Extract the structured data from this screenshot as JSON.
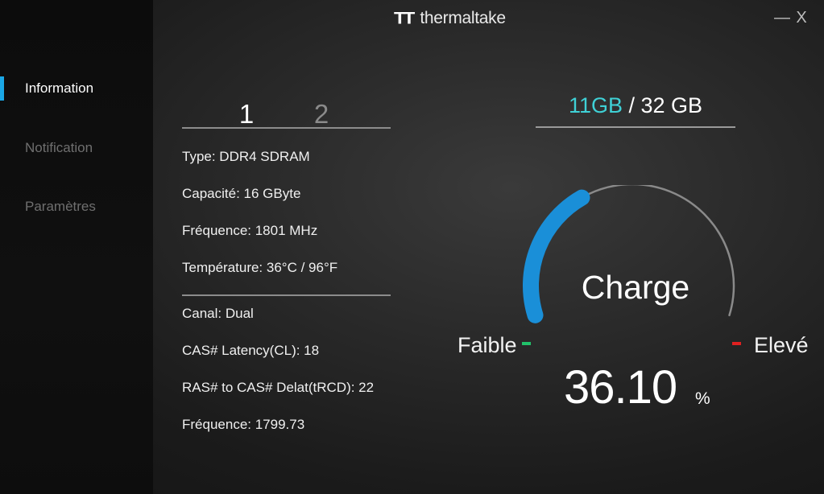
{
  "app": {
    "brand": "thermaltake",
    "logo_mark": "TT",
    "minimize_label": "—",
    "close_label": "X"
  },
  "sidebar": {
    "items": [
      {
        "label": "Information",
        "active": true
      },
      {
        "label": "Notification",
        "active": false
      },
      {
        "label": "Paramètres",
        "active": false
      }
    ]
  },
  "modules": {
    "tabs": [
      {
        "label": "1",
        "active": true
      },
      {
        "label": "2",
        "active": false
      }
    ]
  },
  "info": {
    "type": "Type: DDR4 SDRAM",
    "capacity": "Capacité: 16 GByte",
    "frequency": "Fréquence: 1801 MHz",
    "temperature": "Température: 36°C / 96°F",
    "channel": "Canal: Dual",
    "cas_latency": "CAS# Latency(CL): 18",
    "ras_to_cas": "RAS# to CAS# Delat(tRCD): 22",
    "frequency2": "Fréquence: 1799.73"
  },
  "usage": {
    "used": "11GB",
    "separator": " / ",
    "total": "32 GB"
  },
  "gauge": {
    "title": "Charge",
    "low_label": "Faible",
    "high_label": "Elevé",
    "value": "36.10",
    "unit": "%",
    "percent": 36.1,
    "colors": {
      "arc": "#1a8fd8",
      "track": "#8a8a8a",
      "low": "#21c26a",
      "high": "#e02020"
    }
  }
}
